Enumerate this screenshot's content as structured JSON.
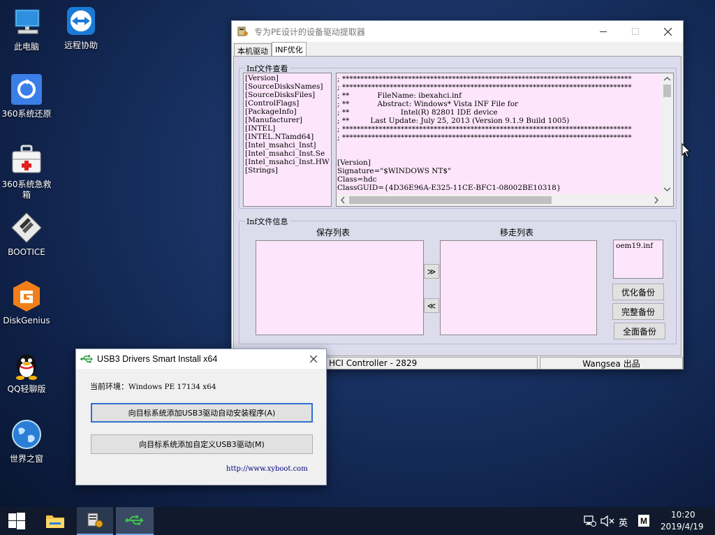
{
  "desktop": {
    "icons": [
      {
        "label": "此电脑",
        "icon": "computer-icon"
      },
      {
        "label": "远程协助",
        "icon": "teamviewer-icon"
      },
      {
        "label": "360系统还原",
        "icon": "restore-icon"
      },
      {
        "label": "360系统急救箱",
        "icon": "first-aid-icon"
      },
      {
        "label": "BOOTICE",
        "icon": "bootice-icon"
      },
      {
        "label": "DiskGenius",
        "icon": "diskgenius-icon"
      },
      {
        "label": "QQ轻聊版",
        "icon": "qq-icon"
      },
      {
        "label": "世界之窗",
        "icon": "globe-icon"
      }
    ]
  },
  "main_window": {
    "title": "专为PE设计的设备驱动提取器",
    "tabs": [
      "本机驱动",
      "INF优化"
    ],
    "active_tab": 1,
    "inf_view": {
      "label": "Inf文件查看",
      "sections": [
        "[Version]",
        "[SourceDisksNames]",
        "[SourceDisksFiles]",
        "[ControlFlags]",
        "[PackageInfo]",
        "[Manufacturer]",
        "[INTEL]",
        "[INTEL.NTamd64]",
        "[Intel_msahci_Inst]",
        "[Intel_msahci_Inst.Se",
        "[Intel_msahci_Inst.HW",
        "[Strings]"
      ],
      "content_lines": [
        "; *******************************************************************************",
        "; *******************************************************************************",
        "; **            FileName: ibexahci.inf",
        "; **            Abstract: Windows* Vista INF File for",
        "; **                      Intel(R) 82801 IDE device",
        "; **         Last Update: July 25, 2013 (Version 9.1.9 Build 1005)",
        "; *******************************************************************************",
        "; *******************************************************************************",
        "",
        "",
        "[Version]",
        "Signature=\"$WINDOWS NT$\"",
        "Class=hdc",
        "ClassGUID={4D36E96A-E325-11CE-BFC1-08002BE10318}"
      ]
    },
    "inf_info": {
      "label": "Inf文件信息",
      "save_list_label": "保存列表",
      "move_list_label": "移走列表",
      "move_right": "≫",
      "move_left": "≪",
      "oem_list": [
        "oem19.inf"
      ],
      "buttons": {
        "optimize": "优化备份",
        "complete": "完整备份",
        "full": "全面备份"
      }
    },
    "status": {
      "left": "HCI Controller - 2829",
      "right": "Wangsea 出品"
    }
  },
  "dialog": {
    "title": "USB3 Drivers Smart Install x64",
    "env_label": "当前环境：",
    "env_value": "Windows PE 17134 x64",
    "btn_auto": "向目标系统添加USB3驱动自动安装程序(A)",
    "btn_custom": "向目标系统添加自定义USB3驱动(M)",
    "link": "http://www.xyboot.com"
  },
  "taskbar": {
    "ime": "英",
    "time": "10:20",
    "date": "2019/4/19"
  }
}
